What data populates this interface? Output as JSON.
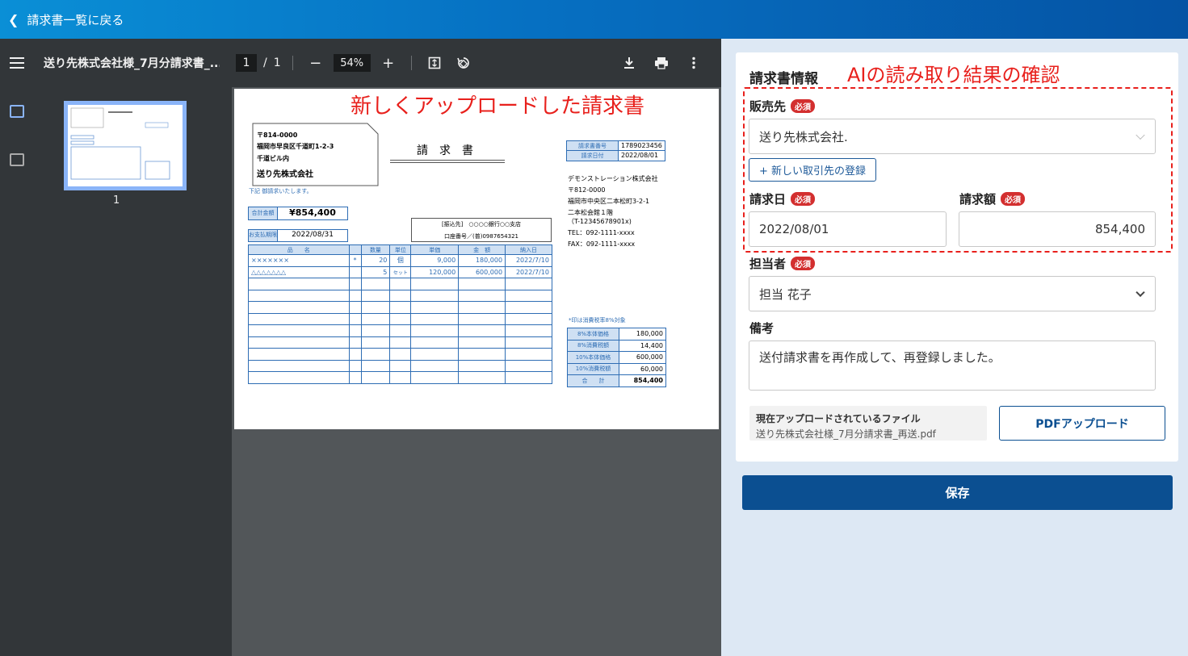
{
  "topbar": {
    "back_label": "請求書一覧に戻る"
  },
  "viewer": {
    "filename": "送り先株式会社様_7月分請求書_...",
    "page_current": "1",
    "page_separator": "/",
    "page_total": "1",
    "zoom": "54%",
    "thumb_page": "1",
    "annotation": "新しくアップロードした請求書"
  },
  "invoice": {
    "postal_to": "〒814-0000",
    "addr_to_1": "福岡市早良区千道町1-2-3",
    "addr_to_2": "千道ビル内",
    "company_to": "送り先株式会社",
    "title": "請　求　書",
    "note_request": "下記 御請求いたします。",
    "no_label": "請求書番号",
    "no_value": "1789023456",
    "date_label": "請求日付",
    "date_value": "2022/08/01",
    "issuer": [
      "デモンストレーション株式会社",
      "〒812-0000",
      "福岡市中央区二本松町3-2-1",
      "二本松会館１階",
      "（T-12345678901x)",
      "TEL：092-1111-xxxx",
      "FAX：092-1111-xxxx"
    ],
    "total_label": "合計金額",
    "total_value": "¥854,400",
    "due_label": "お支払期限",
    "due_value": "2022/08/31",
    "bank_line1": "[振込先]　○○○○銀行○○支店",
    "bank_line2": "口座番号／(普)0987654321",
    "columns": [
      "品　　名",
      "",
      "数量",
      "単位",
      "単価",
      "金　額",
      "納入日"
    ],
    "rows": [
      [
        "×××××××",
        "*",
        "20",
        "個",
        "9,000",
        "180,000",
        "2022/7/10"
      ],
      [
        "△△△△△△△",
        "",
        "5",
        "セット",
        "120,000",
        "600,000",
        "2022/7/10"
      ]
    ],
    "tax_note": "*印は消費税率8%対象",
    "tax_rows": [
      [
        "8%本体価格",
        "180,000"
      ],
      [
        "8%消費税額",
        "14,400"
      ],
      [
        "10%本体価格",
        "600,000"
      ],
      [
        "10%消費税額",
        "60,000"
      ],
      [
        "合　　計",
        "854,400"
      ]
    ]
  },
  "form": {
    "title": "請求書情報",
    "ai_annotation": "AIの読み取り結果の確認",
    "required": "必須",
    "vendor_label": "販売先",
    "vendor_value": "送り先株式会社.",
    "new_vendor_button": "+ 新しい取引先の登録",
    "date_label": "請求日",
    "date_value": "2022/08/01",
    "amount_label": "請求額",
    "amount_value": "854,400",
    "person_label": "担当者",
    "person_value": "担当 花子",
    "note_label": "備考",
    "note_value": "送付請求書を再作成して、再登録しました。",
    "file_heading": "現在アップロードされているファイル",
    "file_name": "送り先株式会社様_7月分請求書_再送.pdf",
    "pdf_upload_button": "PDFアップロード",
    "save_button": "保存"
  }
}
